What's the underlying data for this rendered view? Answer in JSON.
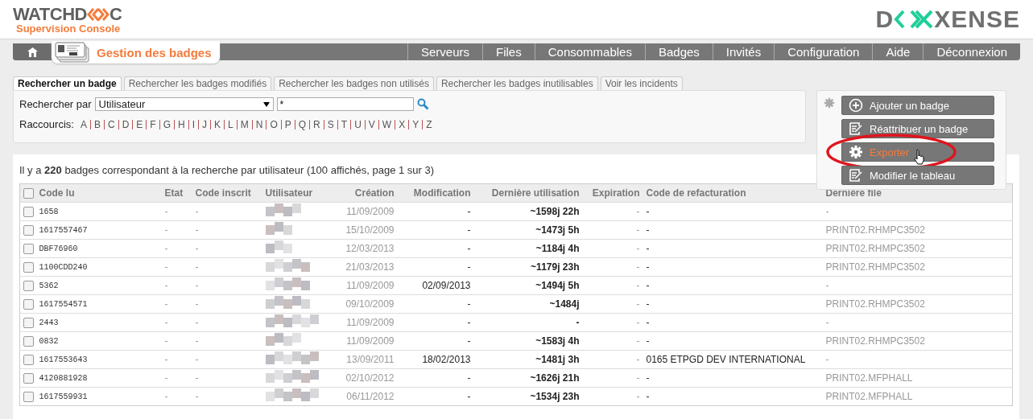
{
  "brand": {
    "before": "WATCHD",
    "after": "C",
    "subtitle": "Supervision Console"
  },
  "partner": {
    "before": "D",
    "after": "XENSE"
  },
  "nav": {
    "current": "Gestion des badges",
    "items": [
      "Serveurs",
      "Files",
      "Consommables",
      "Badges",
      "Invités",
      "Configuration",
      "Aide",
      "Déconnexion"
    ]
  },
  "search_tabs": [
    {
      "label": "Rechercher un badge",
      "selected": true
    },
    {
      "label": "Rechercher les badges modifiés",
      "selected": false
    },
    {
      "label": "Rechercher les badges non utilisés",
      "selected": false
    },
    {
      "label": "Rechercher les badges inutilisables",
      "selected": false
    },
    {
      "label": "Voir les incidents",
      "selected": false
    }
  ],
  "search": {
    "label": "Rechercher par",
    "field": "Utilisateur",
    "value": "*",
    "shortcuts_label": "Raccourcis:",
    "shortcuts": [
      "A",
      "B",
      "C",
      "D",
      "E",
      "F",
      "G",
      "H",
      "I",
      "J",
      "K",
      "L",
      "M",
      "N",
      "O",
      "P",
      "Q",
      "R",
      "S",
      "T",
      "U",
      "V",
      "W",
      "X",
      "Y",
      "Z"
    ]
  },
  "actions": [
    {
      "label": "Ajouter un badge",
      "kind": "add",
      "highlighted": false
    },
    {
      "label": "Réattribuer un badge",
      "kind": "edit",
      "highlighted": false
    },
    {
      "label": "Exporter",
      "kind": "gear",
      "highlighted": true
    },
    {
      "label": "Modifier le tableau",
      "kind": "edit",
      "highlighted": false
    }
  ],
  "summary": "Il y a **220** badges correspondant à la recherche par utilisateur (100 affichés, page 1 sur 3)",
  "table": {
    "all_checked": false,
    "columns": [
      "Code lu",
      "Etat",
      "Code inscrit",
      "Utilisateur",
      "Création",
      "Modification",
      "Dernière utilisation",
      "Expiration",
      "Code de refacturation",
      "Dernière file"
    ],
    "rows": [
      {
        "checked": false,
        "cells": [
          "1658",
          "-",
          "-",
          "",
          "11/09/2009",
          "-",
          "~1598j 22h",
          "-",
          "-",
          "-"
        ]
      },
      {
        "checked": false,
        "cells": [
          "1617557467",
          "-",
          "-",
          "",
          "15/10/2009",
          "-",
          "~1473j 5h",
          "-",
          "-",
          "PRINT02.RHMPC3502"
        ]
      },
      {
        "checked": false,
        "cells": [
          "DBF76960",
          "-",
          "-",
          "",
          "12/03/2013",
          "-",
          "~1184j 4h",
          "-",
          "-",
          "PRINT02.RHMPC3502"
        ]
      },
      {
        "checked": false,
        "cells": [
          "1100CDD240",
          "-",
          "-",
          "",
          "21/03/2013",
          "-",
          "~1179j 23h",
          "-",
          "-",
          "PRINT02.RHMPC3502"
        ]
      },
      {
        "checked": false,
        "cells": [
          "5362",
          "-",
          "-",
          "",
          "11/09/2009",
          "02/09/2013",
          "~1494j 5h",
          "-",
          "-",
          "-"
        ]
      },
      {
        "checked": false,
        "cells": [
          "1617554571",
          "-",
          "-",
          "",
          "09/10/2009",
          "-",
          "~1484j",
          "-",
          "-",
          "PRINT02.RHMPC3502"
        ]
      },
      {
        "checked": false,
        "cells": [
          "2443",
          "-",
          "-",
          "",
          "11/09/2009",
          "-",
          "-",
          "-",
          "-",
          "-"
        ]
      },
      {
        "checked": false,
        "cells": [
          "0832",
          "-",
          "-",
          "",
          "11/09/2009",
          "-",
          "~1583j 4h",
          "-",
          "-",
          "PRINT02.RHMPC3502"
        ]
      },
      {
        "checked": false,
        "cells": [
          "1617553643",
          "-",
          "-",
          "",
          "13/09/2011",
          "18/02/2013",
          "~1481j 3h",
          "-",
          "0165 ETPGD DEV INTERNATIONAL",
          "-"
        ]
      },
      {
        "checked": false,
        "cells": [
          "4120881928",
          "-",
          "-",
          "",
          "02/10/2012",
          "-",
          "~1626j 21h",
          "-",
          "-",
          "PRINT02.MFPHALL"
        ]
      },
      {
        "checked": false,
        "cells": [
          "1617559931",
          "-",
          "-",
          "",
          "06/11/2012",
          "-",
          "~1534j 23h",
          "-",
          "-",
          "PRINT02.MFPHALL"
        ]
      }
    ]
  }
}
